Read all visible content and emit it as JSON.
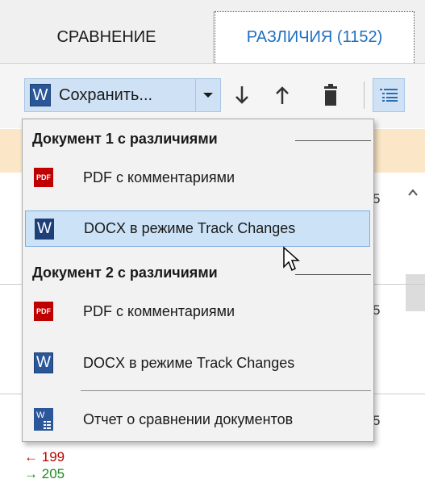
{
  "tabs": [
    {
      "label": "СРАВНЕНИЕ",
      "active": false
    },
    {
      "label": "РАЗЛИЧИЯ (1152)",
      "active": true
    }
  ],
  "toolbar": {
    "save_label": "Сохранить...",
    "icons": [
      "word-icon",
      "chevron-down-icon",
      "arrow-down-icon",
      "arrow-up-icon",
      "trash-icon",
      "list-view-icon"
    ]
  },
  "background": {
    "right_numbers": [
      "5",
      "5",
      "5"
    ],
    "diff_removed": "199",
    "diff_added": "205"
  },
  "menu": {
    "group1": {
      "header": "Документ 1 с различиями",
      "items": [
        {
          "icon": "pdf-icon",
          "label": "PDF с комментариями"
        },
        {
          "icon": "word-icon",
          "label": "DOCX в режиме Track Changes",
          "highlighted": true
        }
      ]
    },
    "group2": {
      "header": "Документ 2 с различиями",
      "items": [
        {
          "icon": "pdf-icon",
          "label": "PDF с комментариями"
        },
        {
          "icon": "word-icon",
          "label": "DOCX в режиме Track Changes"
        }
      ]
    },
    "report": {
      "icon": "word-report-icon",
      "label": "Отчет о сравнении документов"
    },
    "icon_text": {
      "pdf": "PDF",
      "word": "W"
    }
  },
  "colors": {
    "accent_blue": "#1f6fbf",
    "highlight": "#cce2f7",
    "word_blue": "#2b579a",
    "pdf_red": "#c00000",
    "orange_band": "#fbe6c7"
  }
}
